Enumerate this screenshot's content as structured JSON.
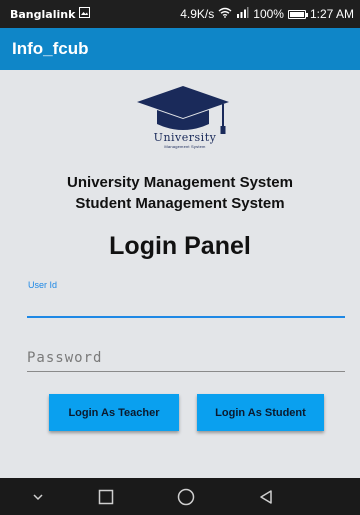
{
  "status_bar": {
    "carrier": "Banglalink",
    "speed": "4.9K/s",
    "battery_percent": "100%",
    "time": "1:27 AM",
    "battery_level": 1.0
  },
  "app_bar": {
    "title": "Info_fcub"
  },
  "logo": {
    "icon": "graduation-cap-icon",
    "title": "University",
    "subtitle": "Management System"
  },
  "headings": {
    "line1": "University Management System",
    "line2": "Student Management System"
  },
  "login": {
    "title": "Login Panel",
    "user_id_label": "User Id",
    "user_id_value": "",
    "password_placeholder": "Password",
    "password_value": "",
    "teacher_button": "Login As Teacher",
    "student_button": "Login As Student"
  },
  "nav_bar": {
    "icons": [
      "chevron-down-icon",
      "recents-square-icon",
      "home-circle-icon",
      "back-triangle-icon"
    ]
  },
  "colors": {
    "app_bar": "#0f86c8",
    "button": "#0aa0ef",
    "accent": "#1e88e5",
    "background": "#e3e5e8",
    "status_bar": "#1f1f1f",
    "nav_bar": "#1a1a1a"
  }
}
